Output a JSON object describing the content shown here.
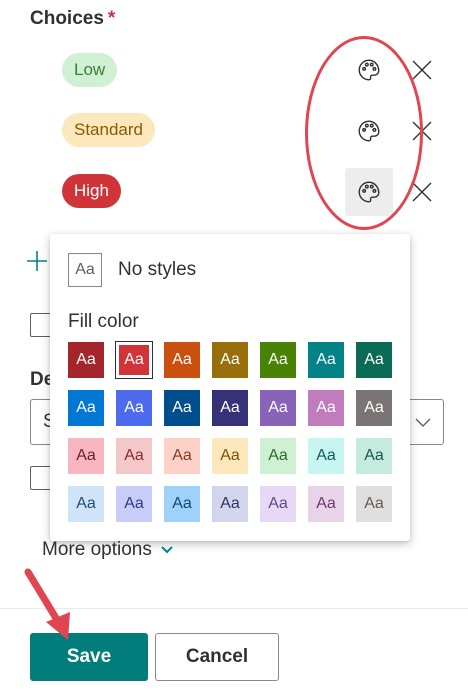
{
  "choices": {
    "label": "Choices",
    "required_marker": "*",
    "items": [
      {
        "label": "Low",
        "bg": "#d0f0d3",
        "fg": "#3c7f34"
      },
      {
        "label": "Standard",
        "bg": "#fde7bd",
        "fg": "#8a5a00"
      },
      {
        "label": "High",
        "bg": "#d13438",
        "fg": "#ffffff"
      }
    ],
    "palette_icon": "palette-icon",
    "remove_icon": "close-icon"
  },
  "background": {
    "add_icon": "plus-icon",
    "section_label_partial": "De",
    "select_value_partial": "S"
  },
  "flyout": {
    "no_styles_swatch": "Aa",
    "no_styles_label": "No styles",
    "fill_color_label": "Fill color",
    "swatch_text": "Aa",
    "swatches": [
      [
        {
          "bg": "#a4262c",
          "fg": "#ffffff"
        },
        {
          "bg": "#d13438",
          "fg": "#ffffff",
          "selected": true
        },
        {
          "bg": "#ca5010",
          "fg": "#ffffff"
        },
        {
          "bg": "#986f0b",
          "fg": "#ffffff"
        },
        {
          "bg": "#498205",
          "fg": "#ffffff"
        },
        {
          "bg": "#038387",
          "fg": "#ffffff"
        },
        {
          "bg": "#0b6a53",
          "fg": "#ffffff"
        }
      ],
      [
        {
          "bg": "#0078d4",
          "fg": "#ffffff"
        },
        {
          "bg": "#4f6bed",
          "fg": "#ffffff"
        },
        {
          "bg": "#004e8c",
          "fg": "#ffffff"
        },
        {
          "bg": "#373277",
          "fg": "#ffffff"
        },
        {
          "bg": "#8764b8",
          "fg": "#ffffff"
        },
        {
          "bg": "#c17cbd",
          "fg": "#ffffff"
        },
        {
          "bg": "#7a7574",
          "fg": "#ffffff"
        }
      ],
      [
        {
          "bg": "#f8b6c1",
          "fg": "#6e1e2a"
        },
        {
          "bg": "#f4c8c8",
          "fg": "#8a2b2b"
        },
        {
          "bg": "#fdd0c8",
          "fg": "#8a3a1c"
        },
        {
          "bg": "#fde7bd",
          "fg": "#7a5200"
        },
        {
          "bg": "#d0f0d3",
          "fg": "#2f6b2a"
        },
        {
          "bg": "#c7f5f2",
          "fg": "#125b5b"
        },
        {
          "bg": "#c5ebe1",
          "fg": "#165c4a"
        }
      ],
      [
        {
          "bg": "#cfe4f8",
          "fg": "#1b4f80"
        },
        {
          "bg": "#c7ccf9",
          "fg": "#313a8a"
        },
        {
          "bg": "#9ed2fb",
          "fg": "#0f4b7a"
        },
        {
          "bg": "#d3d5ee",
          "fg": "#343263"
        },
        {
          "bg": "#e7d9f5",
          "fg": "#5e4a87"
        },
        {
          "bg": "#e8d3e8",
          "fg": "#6b3a6b"
        },
        {
          "bg": "#e1dfdd",
          "fg": "#605e5c"
        }
      ]
    ]
  },
  "more_options": {
    "label": "More options",
    "icon": "chevron-down-icon"
  },
  "footer": {
    "save_label": "Save",
    "cancel_label": "Cancel"
  },
  "annotation_color": "#e04552"
}
